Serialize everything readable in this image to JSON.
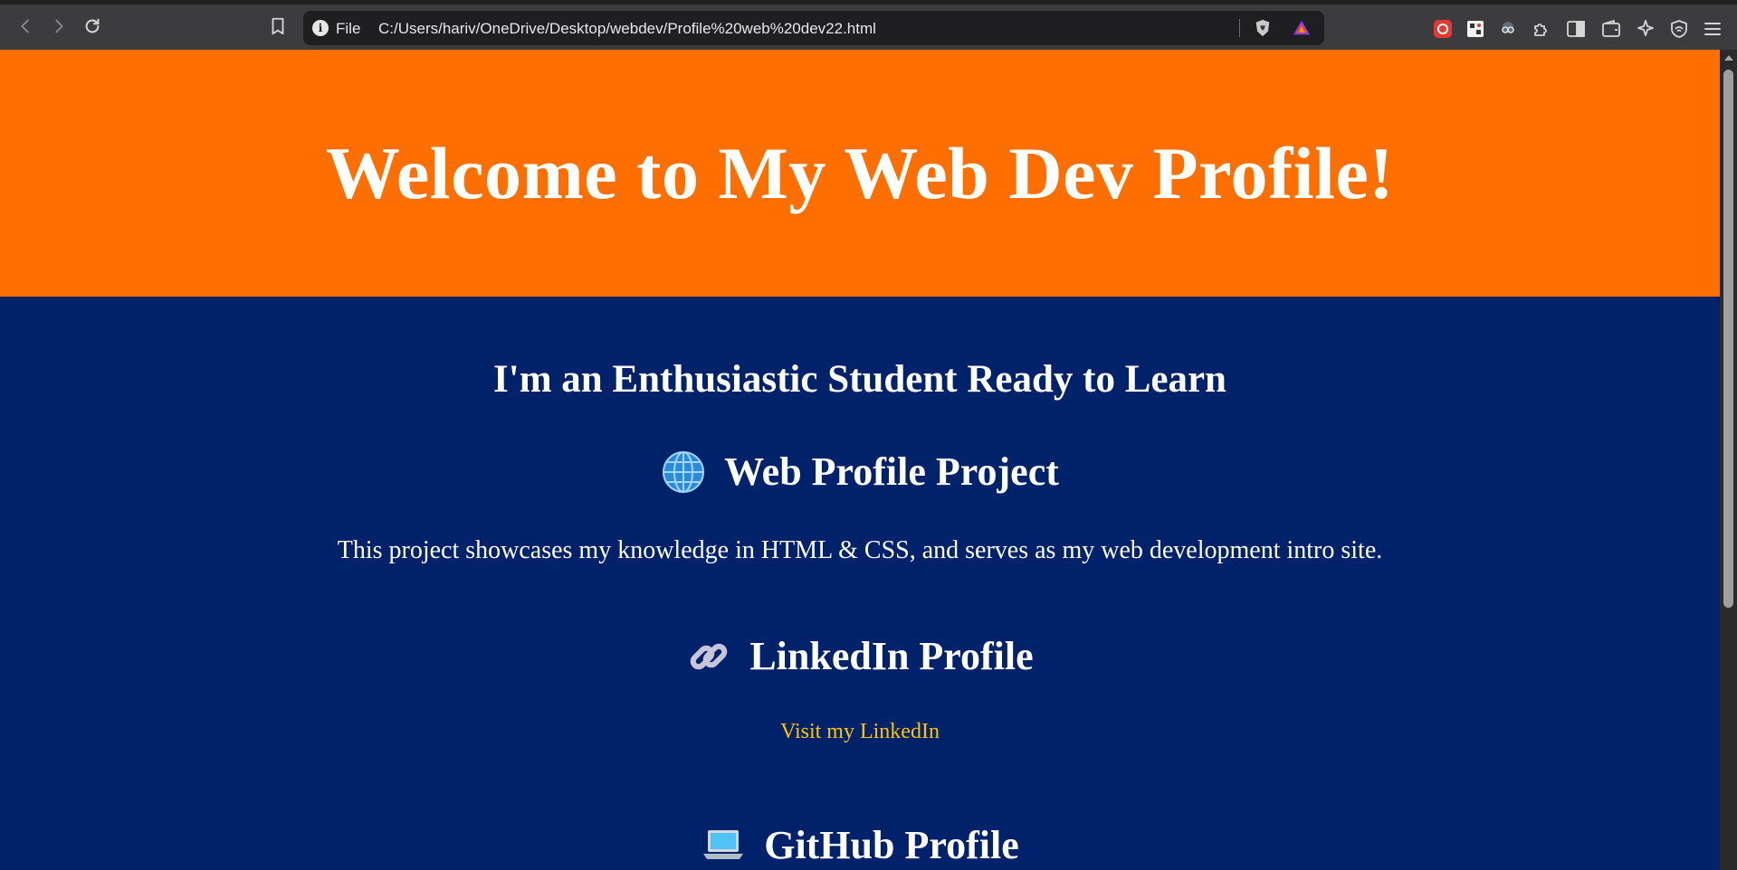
{
  "browser": {
    "url_scheme": "File",
    "url": "C:/Users/hariv/OneDrive/Desktop/webdev/Profile%20web%20dev22.html"
  },
  "page": {
    "hero_title": "Welcome to My Web Dev Profile!",
    "subtitle": "I'm an Enthusiastic Student Ready to Learn",
    "sections": [
      {
        "icon": "globe-icon",
        "title": "Web Profile Project",
        "text": "This project showcases my knowledge in HTML & CSS, and serves as my web development intro site."
      },
      {
        "icon": "link-icon",
        "title": "LinkedIn Profile",
        "link_text": "Visit my LinkedIn"
      },
      {
        "icon": "laptop-icon",
        "title": "GitHub Profile"
      }
    ]
  },
  "colors": {
    "hero_bg": "#ff6f00",
    "main_bg": "#00226a",
    "link": "#ffc400"
  }
}
